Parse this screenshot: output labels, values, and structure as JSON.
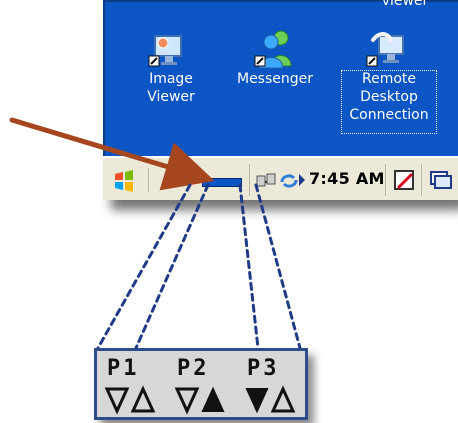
{
  "desktop": {
    "icons": [
      {
        "label_line1": "Image",
        "label_line2": "Viewer"
      },
      {
        "label_line1": "Messenger"
      },
      {
        "label_top": "viewer",
        "label_line1": "Remote",
        "label_line2": "Desktop",
        "label_line3": "Connection"
      }
    ],
    "top_partial": "viewer"
  },
  "taskbar": {
    "time": "7:45 AM"
  },
  "zoom": {
    "labels": [
      "P1",
      "P2",
      "P3"
    ]
  },
  "colors": {
    "desktop": "#0b55c4",
    "arrow": "#a5461f",
    "callout_border": "#2b4d8b"
  }
}
